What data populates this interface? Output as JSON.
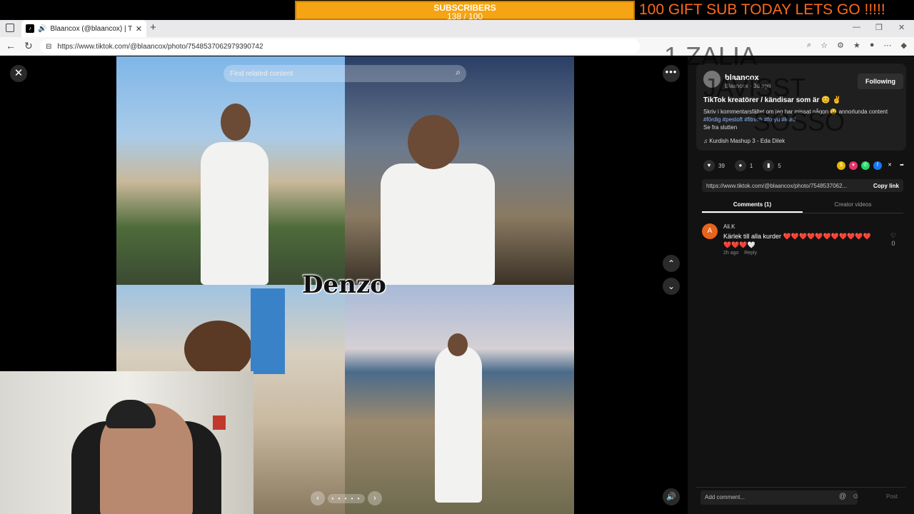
{
  "overlay": {
    "subscribers_label": "SUBSCRIBERS",
    "subscribers_count": "138 / 100",
    "gift_banner": "100 GIFT SUB TODAY LETS GO !!!!!",
    "ov_line1": "1 ZALIA",
    "ov_line2": "JAVISST",
    "ov_line3": "SOSSO"
  },
  "browser": {
    "tab_title": "Blaancox (@blaancox) | TikTok",
    "url": "https://www.tiktok.com/@blaancox/photo/7548537062979390742"
  },
  "viewer": {
    "search_placeholder": "Find related content",
    "caption": "Denzo",
    "dots": "• • • • •"
  },
  "panel": {
    "author_name": "blaancox",
    "author_sub": "Blaancox · 3d ago",
    "follow_label": "Following",
    "post_title": "TikTok kreatörer / kändisar som är 😊 ✌️",
    "post_desc": "Skriv i kommentarsfältet om jag har missat någon 😉 annorlunda content",
    "post_tags": "#fördig #pestoft #fitnich #foryu #kurd",
    "post_desc2": "Se fra slutten",
    "music": "Kurdish Mashup 3 - Eda Dilek",
    "likes": "39",
    "comments": "1",
    "saves": "5",
    "share_url": "https://www.tiktok.com/@blaancox/photo/7548537062...",
    "copy_label": "Copy link",
    "tab_comments": "Comments (1)",
    "tab_creator": "Creator videos",
    "comment": {
      "avatar_letter": "A",
      "user": "Ali.K",
      "text": "Kärlek till alla kurder",
      "hearts": "❤️❤️❤️❤️❤️❤️❤️❤️❤️❤️❤️❤️❤️❤️🤍",
      "time": "2h ago",
      "reply": "Reply",
      "likes": "0"
    },
    "add_comment_placeholder": "Add comment...",
    "post_label": "Post"
  }
}
